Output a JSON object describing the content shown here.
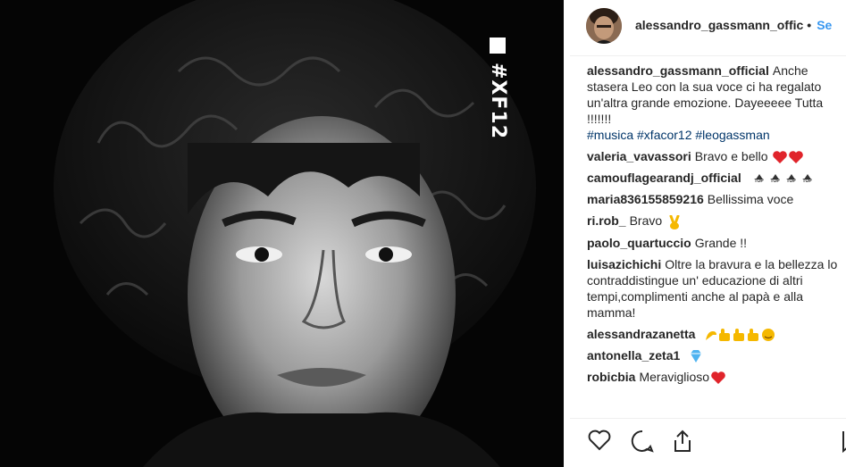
{
  "photo": {
    "hashtag": "#XF12"
  },
  "header": {
    "username": "alessandro_gassmann_offic",
    "separator": "•",
    "follow_label": "Se"
  },
  "caption": {
    "username": "alessandro_gassmann_official",
    "text": "Anche stasera Leo con la sua voce ci ha regalato un'altra grande emozione. Dayeeeee Tutta !!!!!!!",
    "tags": "#musica #xfacor12 #leogassman"
  },
  "comments": [
    {
      "user": "valeria_vavassori",
      "text": "Bravo e bello"
    },
    {
      "user": "camouflagearandj_official",
      "text": ""
    },
    {
      "user": "maria836155859216",
      "text": "Bellissima voce"
    },
    {
      "user": "ri.rob_",
      "text": "Bravo"
    },
    {
      "user": "paolo_quartuccio",
      "text": "Grande !!"
    },
    {
      "user": "luisazichichi",
      "text": "Oltre la bravura e la bellezza lo contraddistingue un' educazione di altri tempi,complimenti anche al papà e alla mamma!"
    },
    {
      "user": "alessandrazanetta",
      "text": ""
    },
    {
      "user": "antonella_zeta1",
      "text": ""
    },
    {
      "user": "robicbia",
      "text": "Meraviglioso"
    }
  ],
  "emoji_labels": {
    "top": "TOP"
  },
  "icons": {
    "like": "heart-icon",
    "comment": "comment-icon",
    "share": "share-icon",
    "save": "bookmark-icon"
  },
  "colors": {
    "link": "#3897f0",
    "hashtag": "#003569",
    "heart": "#e0242b"
  }
}
